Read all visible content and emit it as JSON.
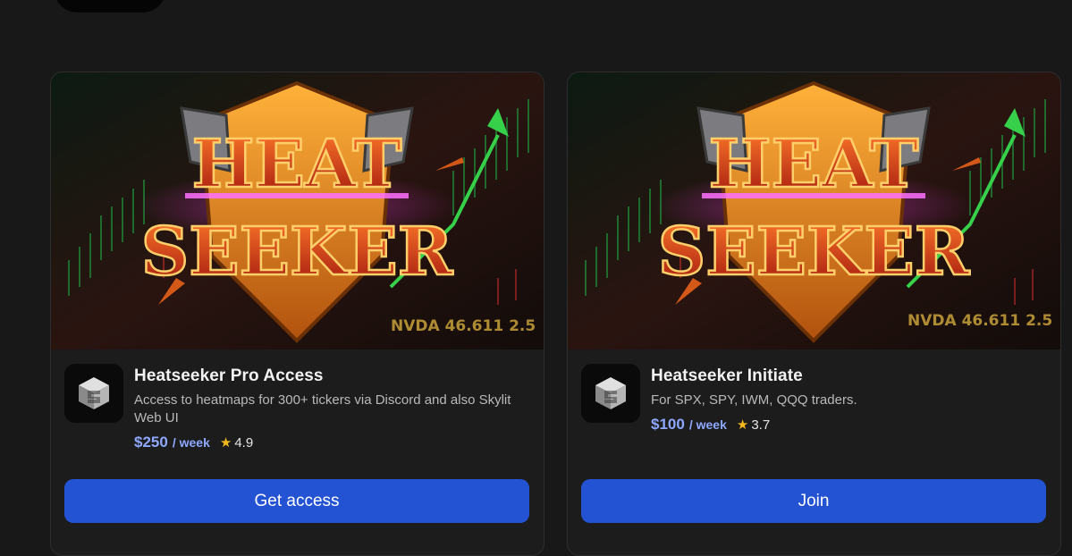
{
  "cards": [
    {
      "title": "Heatseeker Pro Access",
      "description": "Access to heatmaps for 300+ tickers via Discord and also Skylit Web UI",
      "price": "$250",
      "period": "/ week",
      "rating": "4.9",
      "button_label": "Get access",
      "banner": {
        "line1": "HEAT",
        "line2": "SEEKER",
        "ticker": "NVDA  46.611  2.5"
      }
    },
    {
      "title": "Heatseeker Initiate",
      "description": "For SPX, SPY, IWM, QQQ traders.",
      "price": "$100",
      "period": "/ week",
      "rating": "3.7",
      "button_label": "Join",
      "banner": {
        "line1": "HEAT",
        "line2": "SEEKER",
        "ticker": "NVDA  46.611  2.5"
      }
    }
  ],
  "colors": {
    "accent": "#2353d3",
    "price": "#8ea8ff",
    "star": "#f4b81c"
  },
  "icons": {
    "logo": "stacked-s-cube-logo",
    "rating": "star-icon"
  }
}
